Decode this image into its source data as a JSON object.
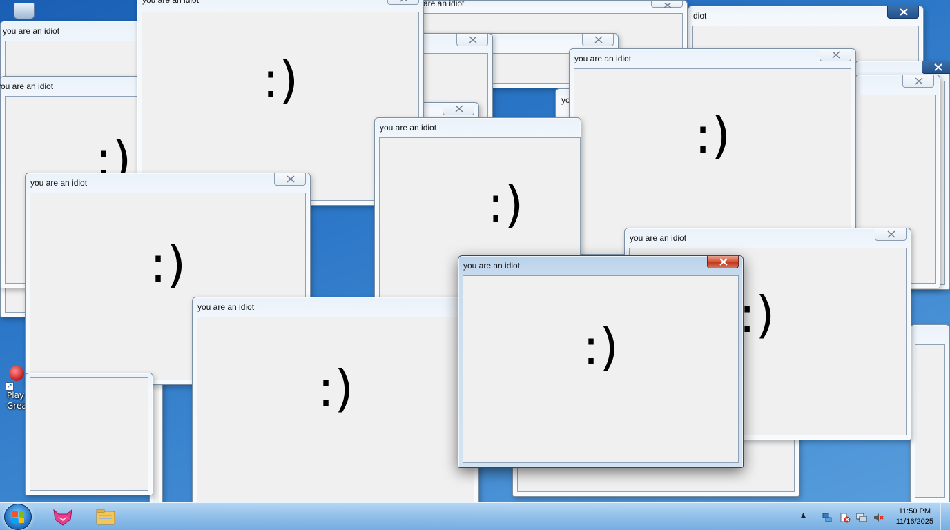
{
  "desktop": {
    "shortcut_label": "Play\nGreat"
  },
  "window_title": "you are an idiot",
  "partial_titles": {
    "a": "are an idiot",
    "b": "diot",
    "c": "yo"
  },
  "smiley": ":)",
  "taskbar": {
    "time": "11:50 PM",
    "date": "11/16/2025",
    "tray_expand": "▲"
  },
  "colors": {
    "accent": "#2d78c8",
    "close_active": "#c2391c"
  }
}
